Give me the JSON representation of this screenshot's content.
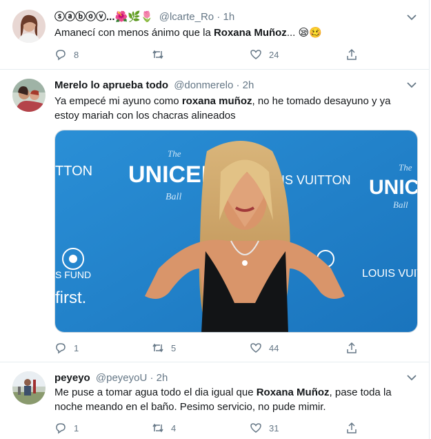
{
  "tweets": [
    {
      "name": "ⓢⓐⓑⓞⓥ...",
      "name_emoji": "🌺🌿🌷",
      "handle": "@lcarte_Ro",
      "time": "1h",
      "text_before": "Amanecí con menos ánimo que la ",
      "text_bold": "Roxana Muñoz",
      "text_after": "... 😪🥴",
      "replies": "8",
      "retweets": "",
      "likes": "24"
    },
    {
      "name": "Merelo lo aprueba todo",
      "handle": "@donmerelo",
      "time": "2h",
      "text_before": "Ya empecé mi ayuno como ",
      "text_bold": "roxana muñoz",
      "text_after": ", no he tomado desayuno y ya estoy mariah con los chacras alineados",
      "media": {
        "backdrop_left": "UNICEF",
        "backdrop_left_sub": "Ball",
        "backdrop_brand": "IS VUITTON",
        "backdrop_right": "UNIC",
        "backdrop_right_sub": "Ball",
        "backdrop_brand2": "LOUIS VUIT",
        "backdrop_ton": "TTON",
        "backdrop_fund": "S FUND",
        "backdrop_first": "first.",
        "backdrop_the": "The",
        "backdrop_the2": "The"
      },
      "replies": "1",
      "retweets": "5",
      "likes": "44"
    },
    {
      "name": "peyeyo",
      "handle": "@peyeyoU",
      "time": "2h",
      "text_before": "Me puse a tomar agua todo el dia igual que ",
      "text_bold": "Roxana Muñoz",
      "text_after": ", pase toda la noche meando en el baño. Pesimo servicio, no pude mimir.",
      "replies": "1",
      "retweets": "4",
      "likes": "31"
    }
  ],
  "dot": "·",
  "colors": {
    "text": "#14171a",
    "secondary": "#657786",
    "unicef_blue": "#1c8ad1"
  }
}
